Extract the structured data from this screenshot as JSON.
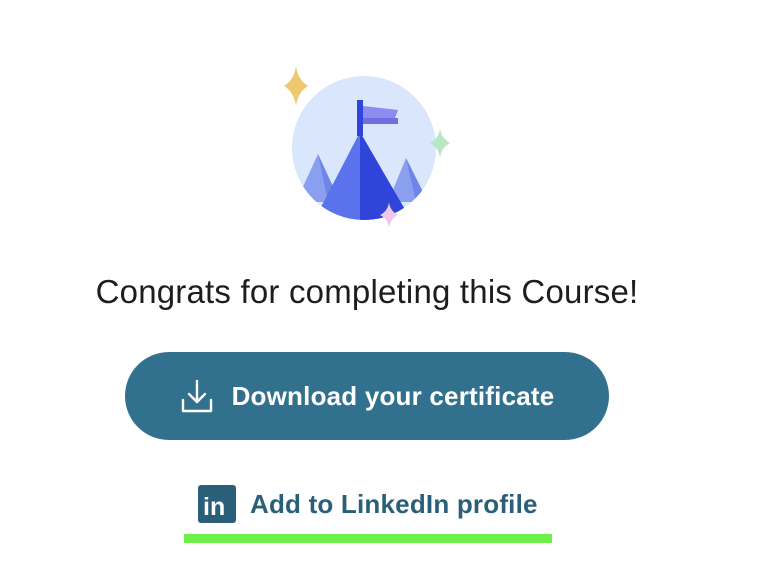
{
  "title": "Congrats for completing this Course!",
  "download_button": {
    "label": "Download your certificate",
    "icon": "download-icon"
  },
  "linkedin_link": {
    "label": "Add to LinkedIn profile",
    "icon": "linkedin-icon",
    "icon_text": "in"
  },
  "illustration": {
    "icon": "mountain-flag-illustration"
  },
  "colors": {
    "button_bg": "#32718e",
    "link_text": "#2a5f79",
    "title_text": "#1c1d1f",
    "highlight": "#6ef04a"
  }
}
